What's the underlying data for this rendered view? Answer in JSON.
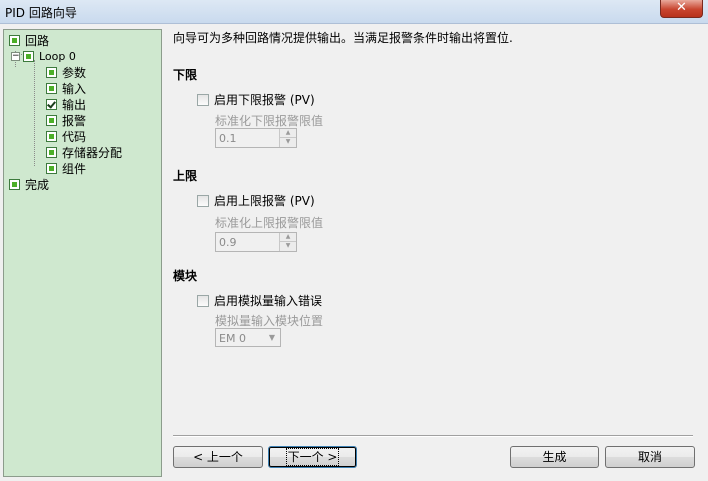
{
  "window": {
    "title": "PID 回路向导",
    "close_glyph": "✕"
  },
  "tree": {
    "root": "回路",
    "loop": "Loop 0",
    "children": [
      "参数",
      "输入",
      "输出",
      "报警",
      "代码",
      "存储器分配",
      "组件"
    ],
    "finish": "完成",
    "expander_glyph": "−"
  },
  "main": {
    "description": "向导可为多种回路情况提供输出。当满足报警条件时输出将置位.",
    "low": {
      "heading": "下限",
      "checkbox_label": "启用下限报警 (PV)",
      "field_label": "标准化下限报警限值",
      "value": "0.1"
    },
    "high": {
      "heading": "上限",
      "checkbox_label": "启用上限报警 (PV)",
      "field_label": "标准化上限报警限值",
      "value": "0.9"
    },
    "module": {
      "heading": "模块",
      "checkbox_label": "启用模拟量输入错误",
      "field_label": "模拟量输入模块位置",
      "value": "EM 0"
    }
  },
  "buttons": {
    "prev": "< 上一个",
    "next": "下一个 >",
    "generate": "生成",
    "cancel": "取消"
  },
  "colors": {
    "tree_bg": "#cfe8cf",
    "check_fill": "#4caf28"
  }
}
